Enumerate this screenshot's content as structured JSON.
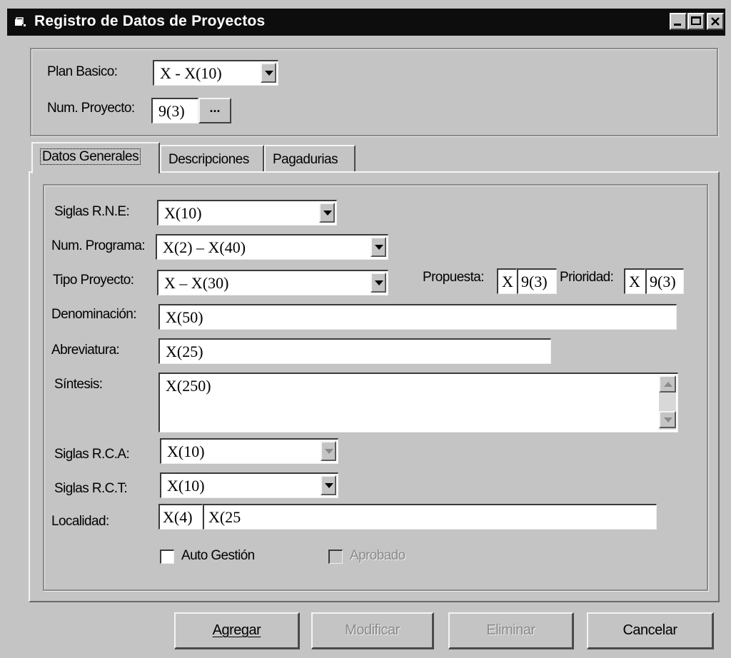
{
  "window": {
    "title": "Registro de Datos de Proyectos",
    "icons": [
      "app-icon",
      "minimize-icon",
      "maximize-icon",
      "close-icon"
    ]
  },
  "header": {
    "plan_basico_label": "Plan Basico:",
    "plan_basico_value": "X - X(10)",
    "num_proyecto_label": "Num. Proyecto:",
    "num_proyecto_value": "9(3)",
    "browse_label": "..."
  },
  "tabs": [
    {
      "label": "Datos Generales",
      "active": true
    },
    {
      "label": "Descripciones",
      "active": false
    },
    {
      "label": "Pagadurias",
      "active": false
    }
  ],
  "form": {
    "siglas_rne": {
      "label": "Siglas R.N.E:",
      "value": "X(10)"
    },
    "num_programa": {
      "label": "Num. Programa:",
      "value": "X(2) – X(40)"
    },
    "tipo_proyecto": {
      "label": "Tipo Proyecto:",
      "value": "X – X(30)"
    },
    "propuesta": {
      "label": "Propuesta:",
      "value1": "X",
      "value2": "9(3)"
    },
    "prioridad": {
      "label": "Prioridad:",
      "value1": "X",
      "value2": "9(3)"
    },
    "denominacion": {
      "label": "Denominación:",
      "value": "X(50)"
    },
    "abreviatura": {
      "label": "Abreviatura:",
      "value": "X(25)"
    },
    "sintesis": {
      "label": "Síntesis:",
      "value": "X(250)"
    },
    "siglas_rca": {
      "label": "Siglas R.C.A:",
      "value": "X(10)"
    },
    "siglas_rct": {
      "label": "Siglas R.C.T:",
      "value": "X(10)"
    },
    "localidad": {
      "label": "Localidad:",
      "value1": "X(4)",
      "value2": "X(25"
    },
    "auto_gestion": {
      "label": "Auto Gestión",
      "checked": false
    },
    "aprobado": {
      "label": "Aprobado",
      "checked": false,
      "disabled": true
    }
  },
  "buttons": {
    "agregar": "Agregar",
    "modificar": "Modificar",
    "eliminar": "Eliminar",
    "cancelar": "Cancelar"
  },
  "colors": {
    "face": "#c4c4c4",
    "titlebar": "#0d0d0d",
    "field": "#ffffff",
    "disabled_text": "#8a8a8a"
  }
}
